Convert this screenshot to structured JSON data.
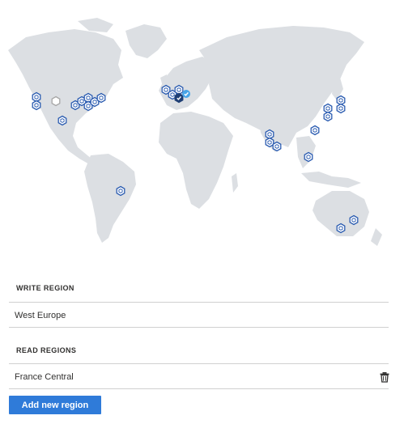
{
  "write_region": {
    "heading": "WRITE REGION",
    "value": "West Europe"
  },
  "read_regions": {
    "heading": "READ REGIONS",
    "items": [
      {
        "name": "France Central",
        "action_icon": "trash-icon"
      }
    ]
  },
  "actions": {
    "add_region_label": "Add new region"
  },
  "colors": {
    "land": "#dcdfe3",
    "region_marker": "#2a5bb0",
    "write_marker": "#1f3f75",
    "read_check": "#48a5e8",
    "button": "#2f7bd9"
  }
}
